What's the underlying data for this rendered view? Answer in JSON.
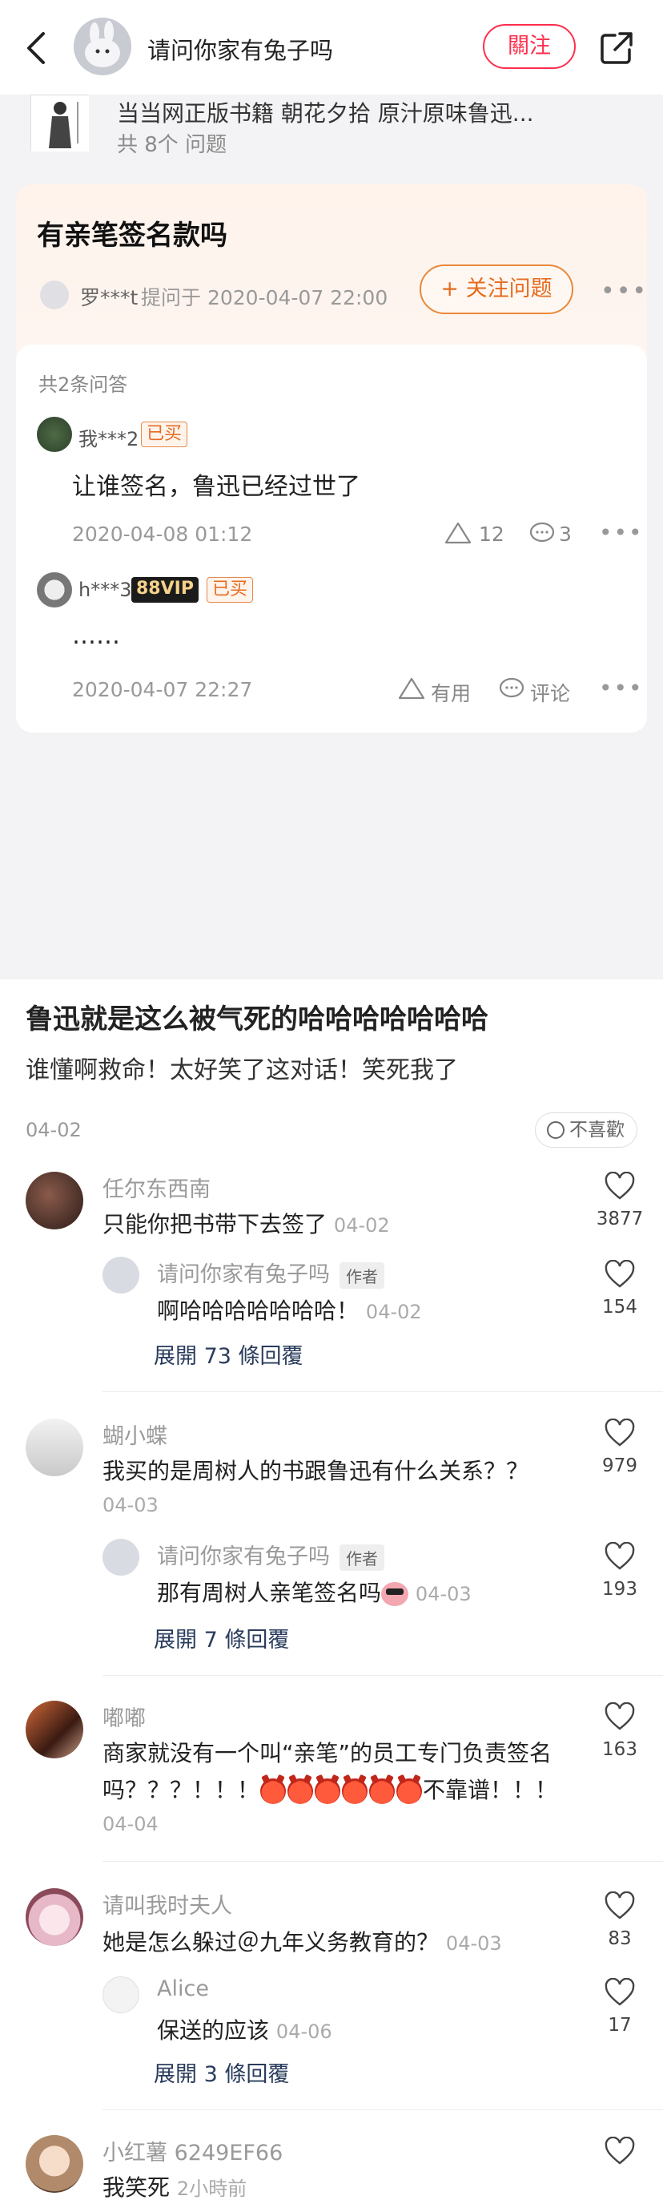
{
  "header": {
    "author_name": "请问你家有兔子吗",
    "follow_label": "關注"
  },
  "screenshot": {
    "book": {
      "title": "当当网正版书籍 朝花夕拾 原汁原味鲁迅...",
      "question_count": "共 8个 问题"
    },
    "question": {
      "title": "有亲笔签名款吗",
      "asker": "罗***t",
      "asked_at": "提问于 2020-04-07 22:00",
      "follow_label": "+ 关注问题",
      "answers_count": "共2条问答"
    },
    "answers": [
      {
        "user": "我***2",
        "bought_tag": "已买",
        "text": "让谁签名，鲁迅已经过世了",
        "date": "2020-04-08 01:12",
        "useful": "12",
        "comments": "3"
      },
      {
        "user": "h***3",
        "vip_tag": "88VIP",
        "bought_tag": "已买",
        "text": "……",
        "date": "2020-04-07 22:27",
        "useful": "有用",
        "comments": "评论"
      }
    ]
  },
  "post": {
    "title": "鲁迅就是这么被气死的哈哈哈哈哈哈哈",
    "body": "谁懂啊救命！太好笑了这对话！笑死我了",
    "date": "04-02",
    "dislike_label": "不喜歡"
  },
  "comments": [
    {
      "user": "任尔东西南",
      "text": "只能你把书带下去签了",
      "time": "04-02",
      "likes": "3877",
      "reply": {
        "user": "请问你家有兔子吗",
        "author_tag": "作者",
        "text": "啊哈哈哈哈哈哈哈！",
        "time": "04-02",
        "likes": "154"
      },
      "expand": "展開 73 條回覆"
    },
    {
      "user": "蝴小蝶",
      "text": "我买的是周树人的书跟鲁迅有什么关系？？",
      "time": "04-03",
      "likes": "979",
      "reply": {
        "user": "请问你家有兔子吗",
        "author_tag": "作者",
        "text": "那有周树人亲笔签名吗",
        "time": "04-03",
        "likes": "193"
      },
      "expand": "展開 7 條回覆"
    },
    {
      "user": "嘟嘟",
      "text_line1": "商家就没有一个叫“亲笔”的员工专门负责签名",
      "text_line2_a": "吗？？？！！！",
      "text_line2_b": "不靠谱！！！",
      "time": "04-04",
      "likes": "163"
    },
    {
      "user": "请叫我时夫人",
      "text": "她是怎么躲过＠九年义务教育的？",
      "time": "04-03",
      "likes": "83",
      "reply": {
        "user": "Alice",
        "text": "保送的应该",
        "time": "04-06",
        "likes": "17"
      },
      "expand": "展開 3 條回覆"
    },
    {
      "user": "小红薯 6249EF66",
      "text": "我笑死",
      "time": "2小時前"
    }
  ]
}
